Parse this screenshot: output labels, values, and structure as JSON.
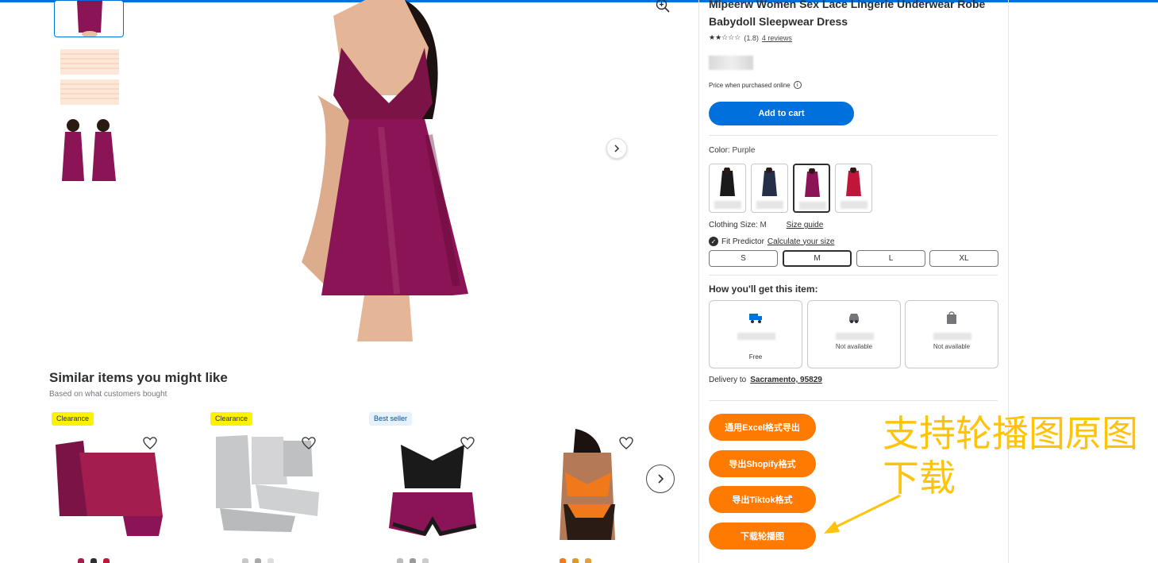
{
  "product": {
    "title": "Mipeerw Women Sex Lace Lingerie Underwear Robe Babydoll Sleepwear Dress",
    "stars": "★★☆☆☆",
    "rating": "(1.8)",
    "reviews": "4 reviews",
    "price_note": "Price when purchased online",
    "add_to_cart": "Add to cart"
  },
  "color": {
    "label": "Color:",
    "value": "Purple"
  },
  "size": {
    "label": "Clothing Size:",
    "value": "M",
    "guide": "Size guide",
    "fit_label": "Fit Predictor",
    "fit_link": "Calculate your size",
    "options": [
      "S",
      "M",
      "L",
      "XL"
    ]
  },
  "fulfillment": {
    "title": "How you'll get this item:",
    "shipping_free": "Free",
    "pickup_status": "Not available",
    "delivery_status": "Not available",
    "delivery_to_label": "Delivery to",
    "delivery_location": "Sacramento, 95829"
  },
  "similar": {
    "title": "Similar items you might like",
    "subtitle": "Based on what customers bought",
    "badges": [
      "Clearance",
      "Clearance",
      "Best seller"
    ]
  },
  "extension": {
    "btn_excel": "通用Excel格式导出",
    "btn_shopify": "导出Shopify格式",
    "btn_tiktok": "导出Tiktok格式",
    "btn_download": "下载轮播图"
  },
  "annotation": "支持轮播图原图下载",
  "colors": {
    "accent": "#0071dc",
    "orange": "#ff7a00",
    "annotation": "#ffc40a",
    "product": "#8b1456"
  }
}
